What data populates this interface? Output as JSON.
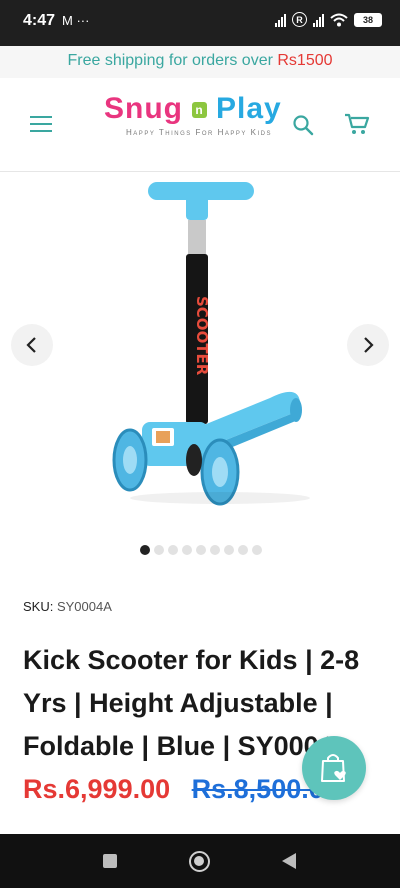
{
  "status_bar": {
    "time": "4:47",
    "left_icons": [
      "mail-icon",
      "more-icon"
    ],
    "left_glyphs": "M ···",
    "r_badge": "R",
    "battery": "38",
    "right_icons": [
      "signal-icon",
      "roaming-icon",
      "signal-icon",
      "wifi-icon",
      "battery-icon"
    ]
  },
  "announcement": {
    "text": "Free shipping for orders over ",
    "amount": "Rs1500",
    "text_color": "#3aa7a0",
    "amount_color": "#e53935"
  },
  "header": {
    "logo": {
      "word1": "Snug",
      "connector": "n",
      "word2": "Play",
      "tagline": "Happy Things For Happy Kids"
    },
    "icons": [
      "hamburger-menu-icon",
      "search-icon",
      "cart-icon"
    ],
    "accent_color": "#3aa7a0"
  },
  "gallery": {
    "image": "blue kick scooter",
    "slide_count": 9,
    "active_slide": 1
  },
  "product": {
    "sku_label": "SKU:",
    "sku_value": "SY0004A",
    "title": "Kick Scooter for Kids | 2-8 Yrs | Height Adjustable | Foldable | Blue | SY0004",
    "price": "Rs.6,999.00",
    "compare_price": "Rs.8,500.00",
    "price_color": "#e53935",
    "compare_color": "#1e6fd9"
  },
  "floating_button": {
    "icon": "shopping-bag-heart-icon",
    "color": "#5ec4bb"
  },
  "nav_bar": {
    "icons": [
      "recents-icon",
      "home-icon",
      "back-icon"
    ]
  }
}
